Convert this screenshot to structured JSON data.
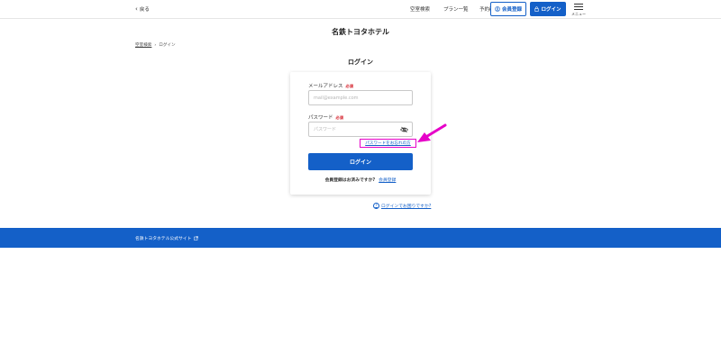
{
  "header": {
    "back_label": "戻る",
    "nav": [
      "空室検索",
      "プラン一覧",
      "予約確認"
    ],
    "register_label": "会員登録",
    "login_label": "ログイン",
    "menu_label": "メニュー"
  },
  "hotel_name": "名鉄トヨタホテル",
  "breadcrumb": {
    "home": "空室検索",
    "current": "ログイン"
  },
  "page_heading": "ログイン",
  "form": {
    "email_label": "メールアドレス",
    "required": "必須",
    "email_placeholder": "mail@example.com",
    "password_label": "パスワード",
    "password_placeholder": "パスワード",
    "forgot_label": "パスワードをお忘れの方",
    "submit_label": "ログイン",
    "register_prompt": "会員登録はお済みですか?",
    "register_link": "会員登録"
  },
  "help_link": "ログインでお困りですか?",
  "footer": {
    "official_site": "名鉄トヨタホテル公式サイト"
  },
  "colors": {
    "primary": "#1460c8",
    "highlight": "#e600c8",
    "required": "#d4202a"
  }
}
